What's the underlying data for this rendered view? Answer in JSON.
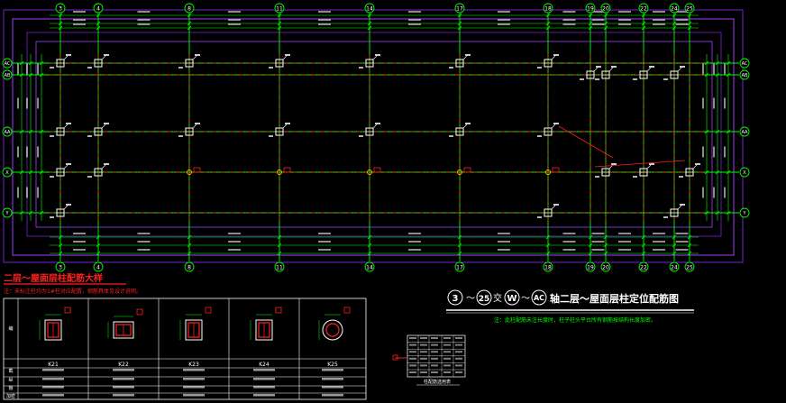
{
  "colors": {
    "background": "#000000",
    "axis": "#00ff00",
    "axis_center_line": "#ff2020",
    "column": "#ffffff",
    "dimension": "#00ff00",
    "outline_outer": "#7a1fd6",
    "outline_inner": "#a040ff",
    "title_red": "#ff2020",
    "table_line": "#ffffff",
    "label_text": "#ffffff",
    "note_green": "#00ff00"
  },
  "plan": {
    "axes_vertical": [
      {
        "label": "3"
      },
      {
        "label": "4"
      },
      {
        "label": "8"
      },
      {
        "label": "11"
      },
      {
        "label": "14"
      },
      {
        "label": "17"
      },
      {
        "label": "18"
      },
      {
        "label": "19"
      },
      {
        "label": "20"
      },
      {
        "label": "22"
      },
      {
        "label": "24"
      },
      {
        "label": "25"
      }
    ],
    "axes_horizontal": [
      {
        "label": "AC"
      },
      {
        "label": "AB"
      },
      {
        "label": "AA"
      },
      {
        "label": "X"
      },
      {
        "label": "Y"
      }
    ]
  },
  "legend": {
    "title": "二层～屋面层柱配筋大样",
    "note": "注：未标注柱均为1#柱对应配置，钢筋具体见设计说明。",
    "headers": [
      "K21",
      "K22",
      "K23",
      "K24",
      "K25"
    ],
    "row_labels": [
      "编",
      "截",
      "纵",
      "箍",
      "加密"
    ]
  },
  "drawing_title": {
    "axis_from": "3",
    "axis_to": "25",
    "word_and": "交",
    "axis_from2": "W",
    "tilde": "～",
    "axis_to2": "AC",
    "text": "轴二层～屋面层柱定位配筋图",
    "note": "注：此柱配筋未注长度时，柱子柱头平台所有钢筋按结构长度加密。"
  },
  "small_table": {
    "caption": "柱配筋选用表"
  }
}
